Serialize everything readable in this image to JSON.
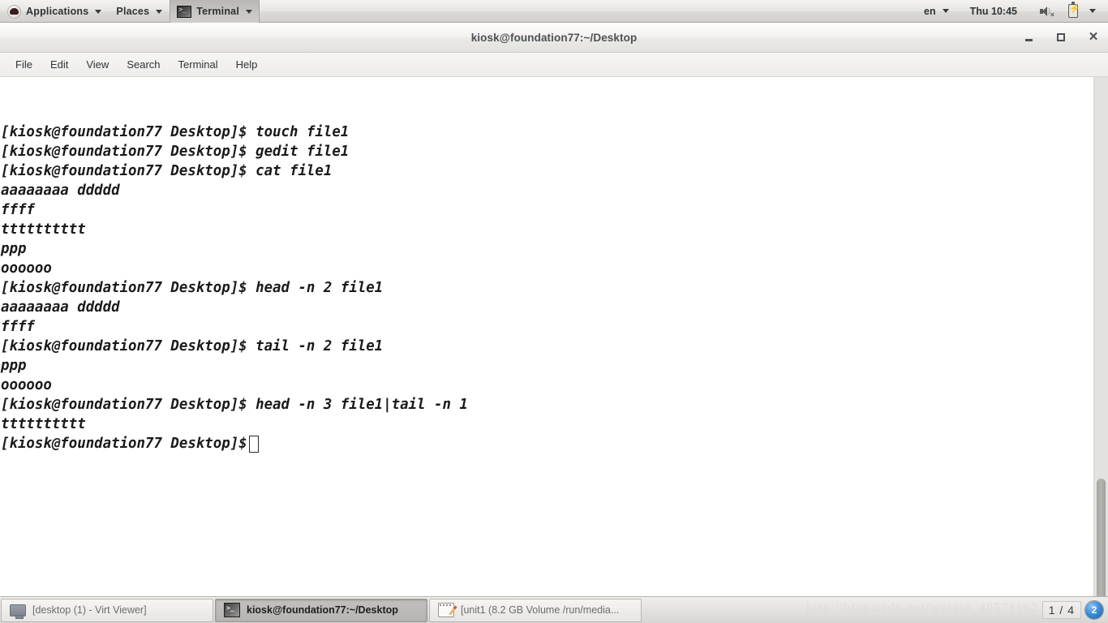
{
  "top_panel": {
    "logo_icon": "redhat-logo-icon",
    "applications_label": "Applications",
    "places_label": "Places",
    "terminal_task_label": "Terminal",
    "terminal_task_icon": "terminal-icon",
    "language_label": "en",
    "clock": "Thu 10:45",
    "volume_icon": "speaker-muted-icon",
    "battery_icon": "battery-charging-icon",
    "system_menu_icon": "chevron-down-icon"
  },
  "window": {
    "title": "kiosk@foundation77:~/Desktop",
    "controls": {
      "minimize": "minimize-icon",
      "maximize": "maximize-icon",
      "close": "close-icon"
    },
    "menus": [
      "File",
      "Edit",
      "View",
      "Search",
      "Terminal",
      "Help"
    ]
  },
  "terminal": {
    "prompt": "[kiosk@foundation77 Desktop]$",
    "lines": [
      "",
      "",
      "[kiosk@foundation77 Desktop]$ touch file1",
      "[kiosk@foundation77 Desktop]$ gedit file1",
      "[kiosk@foundation77 Desktop]$ cat file1",
      "aaaaaaaa ddddd",
      "ffff",
      "tttttttttt",
      "ppp",
      "oooooo",
      "[kiosk@foundation77 Desktop]$ head -n 2 file1",
      "aaaaaaaa ddddd",
      "ffff",
      "[kiosk@foundation77 Desktop]$ tail -n 2 file1",
      "ppp",
      "oooooo",
      "[kiosk@foundation77 Desktop]$ head -n 3 file1|tail -n 1",
      "tttttttttt"
    ],
    "last_prompt": "[kiosk@foundation77 Desktop]$",
    "cursor": "block-cursor"
  },
  "taskbar": {
    "items": [
      {
        "label": "[desktop (1) - Virt Viewer]",
        "icon": "monitor-icon",
        "active": false
      },
      {
        "label": "kiosk@foundation77:~/Desktop",
        "icon": "terminal-icon",
        "active": true
      },
      {
        "label": "[unit1 (8.2 GB Volume /run/media...",
        "icon": "gedit-icon",
        "active": false
      }
    ],
    "watermark": "http://blog.csdn.net/weixin_40571162",
    "workspace_pager": "1 / 4",
    "workspace_badge": "2"
  }
}
